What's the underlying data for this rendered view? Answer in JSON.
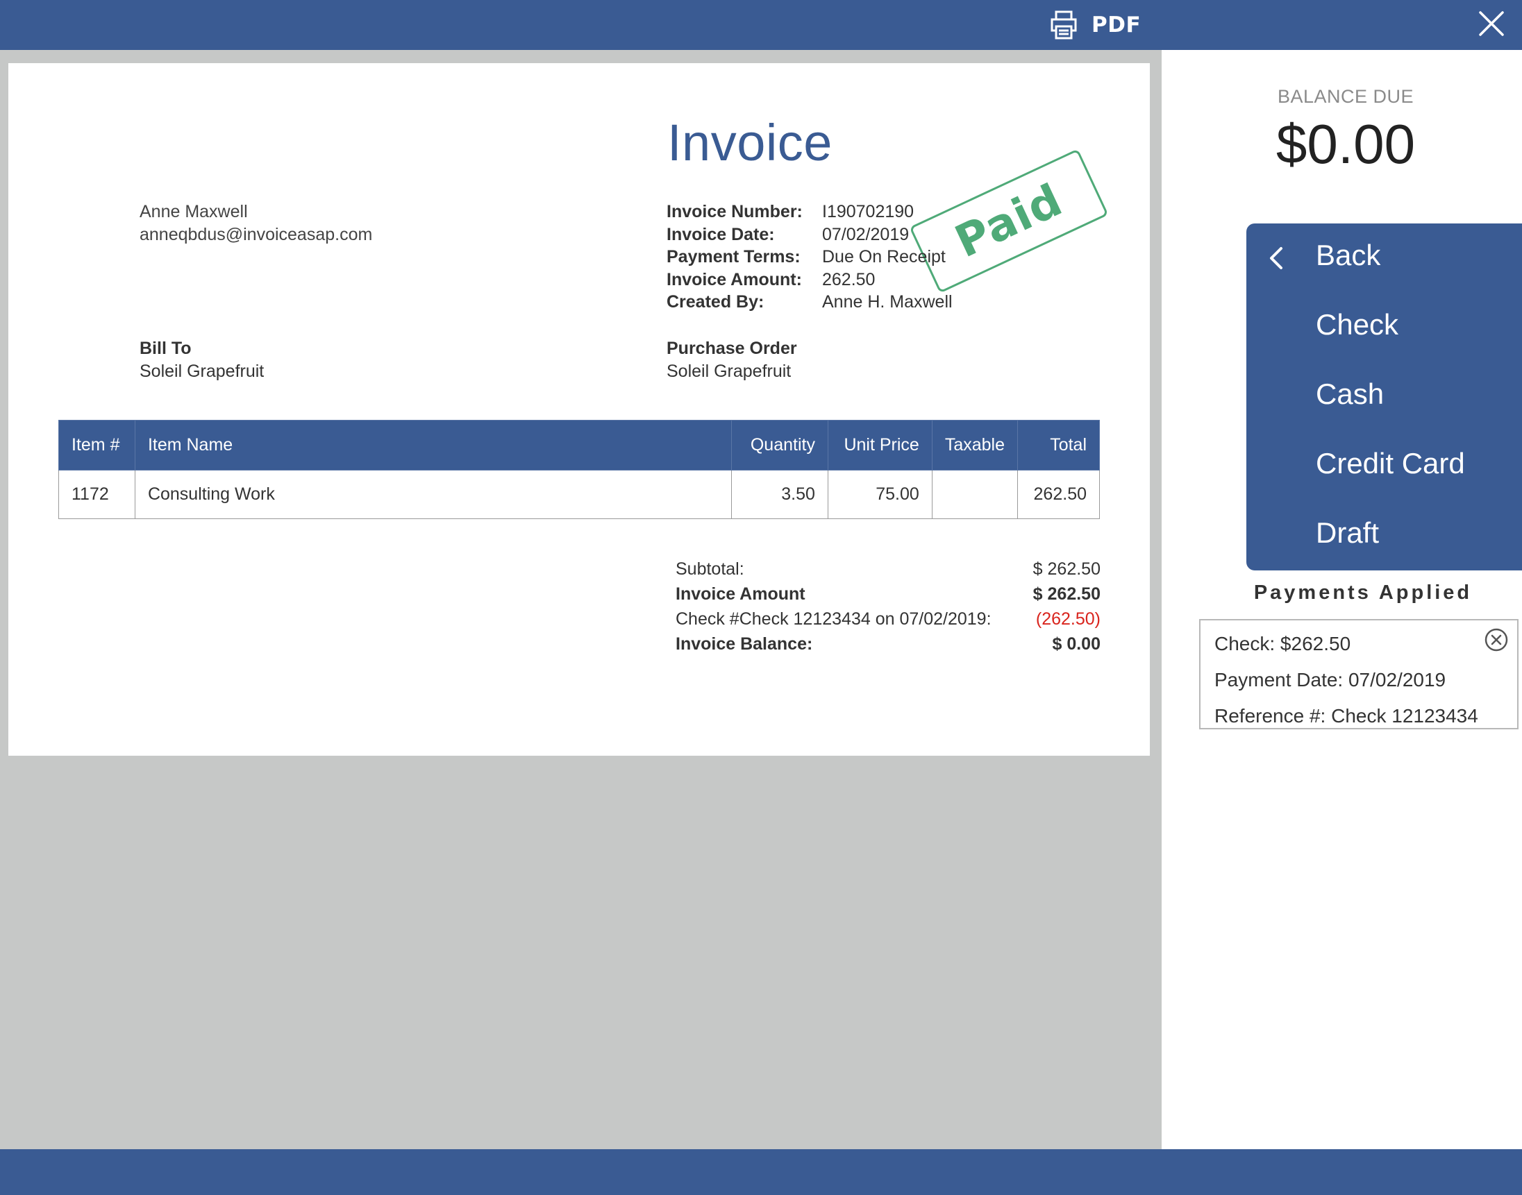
{
  "toolbar": {
    "pdf_label": "PDF",
    "icons": [
      "printer-icon",
      "close-icon"
    ]
  },
  "invoice": {
    "title": "Invoice",
    "stamp": "Paid",
    "sender": {
      "name": "Anne Maxwell",
      "email": "anneqbdus@invoiceasap.com"
    },
    "meta": [
      {
        "label": "Invoice Number:",
        "value": "I190702190"
      },
      {
        "label": "Invoice Date:",
        "value": "07/02/2019"
      },
      {
        "label": "Payment Terms:",
        "value": "Due On Receipt"
      },
      {
        "label": "Invoice Amount:",
        "value": "262.50"
      },
      {
        "label": "Created By:",
        "value": "Anne H. Maxwell"
      }
    ],
    "bill_to": {
      "label": "Bill To",
      "value": "Soleil Grapefruit"
    },
    "purchase_order": {
      "label": "Purchase Order",
      "value": "Soleil Grapefruit"
    },
    "table": {
      "headers": [
        "Item #",
        "Item Name",
        "Quantity",
        "Unit Price",
        "Taxable",
        "Total"
      ],
      "rows": [
        {
          "item_no": "1172",
          "name": "Consulting Work",
          "quantity": "3.50",
          "unit_price": "75.00",
          "taxable": "",
          "total": "262.50"
        }
      ]
    },
    "totals": [
      {
        "label": "Subtotal:",
        "value": "$ 262.50"
      },
      {
        "label": "Invoice Amount",
        "value": "$ 262.50"
      },
      {
        "label": "Check #Check 12123434 on 07/02/2019:",
        "value": "(262.50)"
      },
      {
        "label": "Invoice Balance:",
        "value": "$ 0.00"
      }
    ]
  },
  "panel": {
    "balance_label": "BALANCE DUE",
    "balance_amount": "$0.00",
    "menu": {
      "back": "Back",
      "items": [
        "Check",
        "Cash",
        "Credit Card",
        "Draft"
      ]
    },
    "payments_title": "Payments Applied",
    "payment": {
      "line1": "Check: $262.50",
      "line2": "Payment Date: 07/02/2019",
      "line3": "Reference #: Check 12123434"
    }
  },
  "colors": {
    "brand": "#3a5b93",
    "paid_stamp": "#4faa78",
    "negative": "#d9241d",
    "background": "#c6c8c7"
  }
}
